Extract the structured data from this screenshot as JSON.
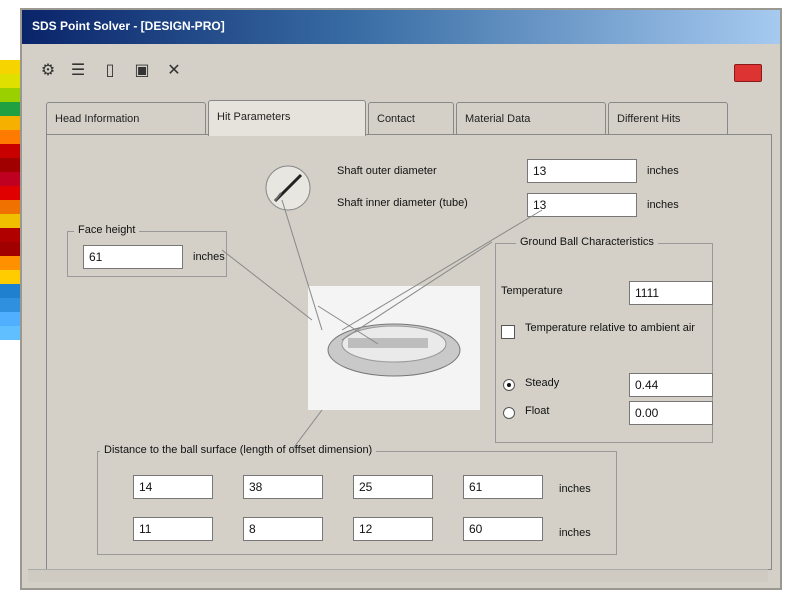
{
  "window": {
    "title": "SDS Point Solver - [DESIGN-PRO]"
  },
  "toolbar": {
    "icons": [
      "settings-icon",
      "list-icon",
      "new-document-icon",
      "save-icon",
      "delete-icon"
    ]
  },
  "tabs": [
    {
      "label": "Head Information"
    },
    {
      "label": "Hit Parameters"
    },
    {
      "label": "Contact"
    },
    {
      "label": "Material Data"
    },
    {
      "label": "Different Hits"
    }
  ],
  "panel": {
    "shaft_outer": {
      "label": "Shaft outer diameter",
      "value": "13",
      "unit": "inches"
    },
    "shaft_inner": {
      "label": "Shaft inner diameter (tube)",
      "value": "13",
      "unit": "inches"
    },
    "face_height": {
      "label": "Face height",
      "value": "61",
      "unit": "inches"
    },
    "ground_box": {
      "title": "Ground Ball Characteristics",
      "temperature_label": "Temperature",
      "temperature_value": "1111",
      "temp_checkbox_label": "Temperature relative to ambient air",
      "option_a": "Steady",
      "option_a_value": "0.44",
      "option_b": "Float",
      "option_b_value": "0.00"
    },
    "distance_box": {
      "title": "Distance to the ball surface (length of offset dimension)",
      "row1": [
        "14",
        "38",
        "25",
        "61"
      ],
      "row2": [
        "11",
        "8",
        "12",
        "60"
      ],
      "unit": "inches"
    }
  },
  "colors": {
    "title_start": "#0a246a",
    "title_end": "#a6caf0",
    "dialog_bg": "#d4d0c8",
    "close_red": "#dd3333"
  },
  "bg_strip": [
    "#f5d400",
    "#e0e000",
    "#9ad000",
    "#20a040",
    "#f5b000",
    "#ff7a00",
    "#c80000",
    "#a00000",
    "#c00020",
    "#e00000",
    "#f07000",
    "#f0c000",
    "#b00000",
    "#a00000",
    "#ff9000",
    "#ffcc00",
    "#2080d0",
    "#3090e0",
    "#50b0ff",
    "#60c0ff"
  ]
}
